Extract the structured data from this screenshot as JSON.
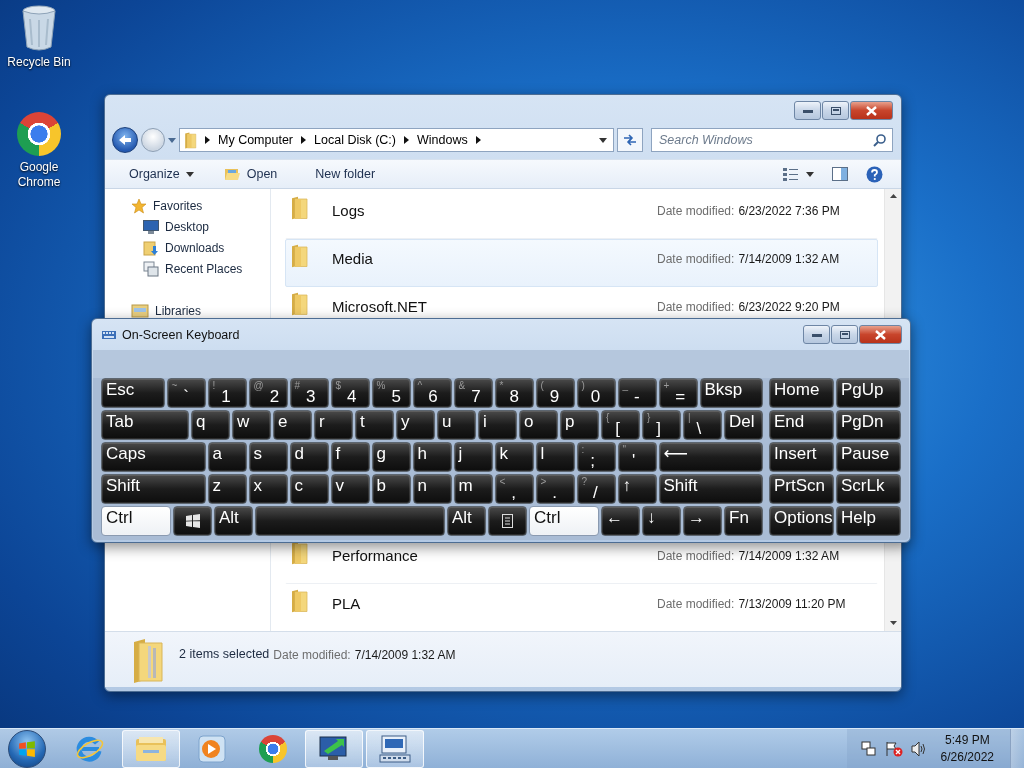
{
  "desktop_icons": [
    {
      "kind": "bin",
      "label": "Recycle Bin"
    },
    {
      "kind": "chrome",
      "label": "Google Chrome"
    }
  ],
  "explorer": {
    "address": {
      "crumbs": [
        "My Computer",
        "Local Disk (C:)",
        "Windows"
      ]
    },
    "search": {
      "placeholder": "Search Windows"
    },
    "toolbar": {
      "organize": "Organize",
      "open": "Open",
      "new_folder": "New folder"
    },
    "sidebar": {
      "groups": [
        {
          "label": "Favorites",
          "kind": "star",
          "children": [
            {
              "label": "Desktop",
              "kind": "desktop"
            },
            {
              "label": "Downloads",
              "kind": "downloads"
            },
            {
              "label": "Recent Places",
              "kind": "recent"
            }
          ]
        },
        {
          "label": "Libraries",
          "kind": "library"
        }
      ]
    },
    "files_top": [
      {
        "name": "Logs",
        "date_label": "Date modified:",
        "date": "6/23/2022 7:36 PM",
        "selected": false
      },
      {
        "name": "Media",
        "date_label": "Date modified:",
        "date": "7/14/2009 1:32 AM",
        "selected": true
      },
      {
        "name": "Microsoft.NET",
        "date_label": "Date modified:",
        "date": "6/23/2022 9:20 PM",
        "selected": false
      }
    ],
    "files_bottom": [
      {
        "name": "Performance",
        "date_label": "Date modified:",
        "date": "7/14/2009 1:32 AM",
        "selected": false
      },
      {
        "name": "PLA",
        "date_label": "Date modified:",
        "date": "7/13/2009 11:20 PM",
        "selected": false
      }
    ],
    "status": {
      "count": "2 items selected",
      "date_label": "Date modified:",
      "date": "7/14/2009 1:32 AM"
    }
  },
  "keyboard": {
    "title": "On-Screen Keyboard",
    "rows": [
      {
        "keys": [
          {
            "kind": "wide",
            "label": "Esc",
            "on": false
          },
          {
            "kind": "symbol",
            "top": "~",
            "label": "`",
            "on": false
          },
          {
            "kind": "symbol",
            "top": "!",
            "label": "1",
            "on": false
          },
          {
            "kind": "symbol",
            "top": "@",
            "label": "2",
            "on": false
          },
          {
            "kind": "symbol",
            "top": "#",
            "label": "3",
            "on": false
          },
          {
            "kind": "symbol",
            "top": "$",
            "label": "4",
            "on": false
          },
          {
            "kind": "symbol",
            "top": "%",
            "label": "5",
            "on": false
          },
          {
            "kind": "symbol",
            "top": "^",
            "label": "6",
            "on": false
          },
          {
            "kind": "symbol",
            "top": "&",
            "label": "7",
            "on": false
          },
          {
            "kind": "symbol",
            "top": "*",
            "label": "8",
            "on": false
          },
          {
            "kind": "symbol",
            "top": "(",
            "label": "9",
            "on": false
          },
          {
            "kind": "symbol",
            "top": ")",
            "label": "0",
            "on": false
          },
          {
            "kind": "symbol",
            "top": "_",
            "label": "-",
            "on": false
          },
          {
            "kind": "symbol",
            "top": "+",
            "label": "=",
            "on": false
          },
          {
            "kind": "wide",
            "label": "Bksp",
            "on": false
          }
        ],
        "nav": [
          {
            "label": "Home",
            "on": false
          },
          {
            "label": "PgUp",
            "on": false
          }
        ]
      },
      {
        "keys": [
          {
            "kind": "wide",
            "label": "Tab",
            "on": false
          },
          {
            "kind": "letter",
            "label": "q",
            "on": false
          },
          {
            "kind": "letter",
            "label": "w",
            "on": false
          },
          {
            "kind": "letter",
            "label": "e",
            "on": false
          },
          {
            "kind": "letter",
            "label": "r",
            "on": false
          },
          {
            "kind": "letter",
            "label": "t",
            "on": false
          },
          {
            "kind": "letter",
            "label": "y",
            "on": false
          },
          {
            "kind": "letter",
            "label": "u",
            "on": false
          },
          {
            "kind": "letter",
            "label": "i",
            "on": false
          },
          {
            "kind": "letter",
            "label": "o",
            "on": false
          },
          {
            "kind": "letter",
            "label": "p",
            "on": false
          },
          {
            "kind": "symbol",
            "top": "{",
            "label": "[",
            "on": false
          },
          {
            "kind": "symbol",
            "top": "}",
            "label": "]",
            "on": false
          },
          {
            "kind": "symbol",
            "top": "|",
            "label": "\\",
            "on": false
          },
          {
            "kind": "letter",
            "label": "Del",
            "on": false
          }
        ],
        "nav": [
          {
            "label": "End",
            "on": false
          },
          {
            "label": "PgDn",
            "on": false
          }
        ]
      },
      {
        "keys": [
          {
            "kind": "wide",
            "label": "Caps",
            "on": false
          },
          {
            "kind": "letter",
            "label": "a",
            "on": false
          },
          {
            "kind": "letter",
            "label": "s",
            "on": false
          },
          {
            "kind": "letter",
            "label": "d",
            "on": false
          },
          {
            "kind": "letter",
            "label": "f",
            "on": false
          },
          {
            "kind": "letter",
            "label": "g",
            "on": false
          },
          {
            "kind": "letter",
            "label": "h",
            "on": false
          },
          {
            "kind": "letter",
            "label": "j",
            "on": false
          },
          {
            "kind": "letter",
            "label": "k",
            "on": false
          },
          {
            "kind": "letter",
            "label": "l",
            "on": false
          },
          {
            "kind": "symbol",
            "top": ":",
            "label": ";",
            "on": false
          },
          {
            "kind": "symbol",
            "top": "\"",
            "label": "'",
            "on": false
          },
          {
            "kind": "wide",
            "label": "⟵",
            "on": false
          }
        ],
        "nav": [
          {
            "label": "Insert",
            "on": false
          },
          {
            "label": "Pause",
            "on": false
          }
        ]
      },
      {
        "keys": [
          {
            "kind": "wide",
            "label": "Shift",
            "on": false
          },
          {
            "kind": "letter",
            "label": "z",
            "on": false
          },
          {
            "kind": "letter",
            "label": "x",
            "on": false
          },
          {
            "kind": "letter",
            "label": "c",
            "on": false
          },
          {
            "kind": "letter",
            "label": "v",
            "on": false
          },
          {
            "kind": "letter",
            "label": "b",
            "on": false
          },
          {
            "kind": "letter",
            "label": "n",
            "on": false
          },
          {
            "kind": "letter",
            "label": "m",
            "on": false
          },
          {
            "kind": "symbol",
            "top": "<",
            "label": ",",
            "on": false
          },
          {
            "kind": "symbol",
            "top": ">",
            "label": ".",
            "on": false
          },
          {
            "kind": "symbol",
            "top": "?",
            "label": "/",
            "on": false
          },
          {
            "kind": "letter",
            "label": "↑",
            "on": false
          },
          {
            "kind": "wide",
            "label": "Shift",
            "on": false
          }
        ],
        "nav": [
          {
            "label": "PrtScn",
            "on": false
          },
          {
            "label": "ScrLk",
            "on": false
          }
        ]
      },
      {
        "keys": [
          {
            "kind": "wide",
            "label": "Ctrl",
            "on": true
          },
          {
            "kind": "winlogo",
            "on": false
          },
          {
            "kind": "letter",
            "label": "Alt",
            "on": false
          },
          {
            "kind": "space",
            "on": false
          },
          {
            "kind": "letter",
            "label": "Alt",
            "on": false
          },
          {
            "kind": "menu",
            "on": false
          },
          {
            "kind": "wide",
            "label": "Ctrl",
            "on": true
          },
          {
            "kind": "letter",
            "label": "←",
            "on": false
          },
          {
            "kind": "letter",
            "label": "↓",
            "on": false
          },
          {
            "kind": "letter",
            "label": "→",
            "on": false
          },
          {
            "kind": "letter",
            "label": "Fn",
            "on": false
          }
        ],
        "nav": [
          {
            "label": "Options",
            "on": false
          },
          {
            "label": "Help",
            "on": false
          }
        ]
      }
    ]
  },
  "taskbar": {
    "apps": [
      {
        "kind": "ie",
        "active": false
      },
      {
        "kind": "explorer",
        "active": true
      },
      {
        "kind": "media",
        "active": false
      },
      {
        "kind": "chrome",
        "active": false
      },
      {
        "kind": "remote",
        "active": true
      },
      {
        "kind": "keyboard",
        "active": true
      }
    ],
    "clock": {
      "time": "5:49 PM",
      "date": "6/26/2022"
    }
  }
}
